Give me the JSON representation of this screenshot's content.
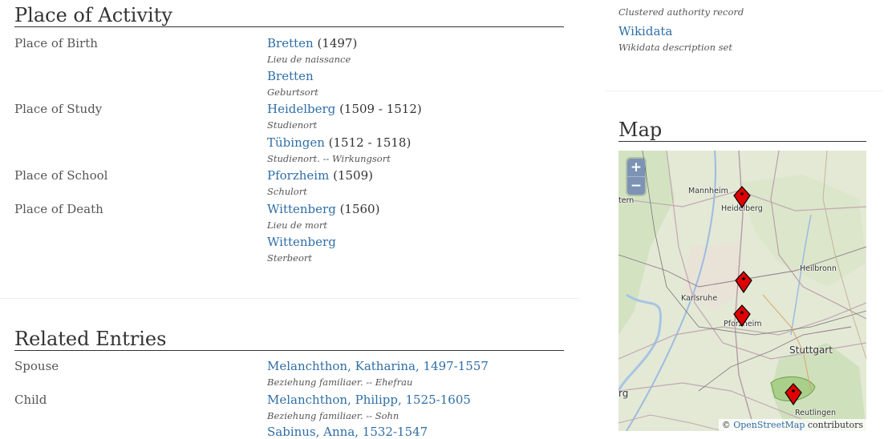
{
  "place_section": {
    "title": "Place of Activity",
    "rows": [
      {
        "label": "Place of Birth",
        "entries": [
          {
            "link": "Bretten",
            "years": "(1497)",
            "note": "Lieu de naissance"
          },
          {
            "link": "Bretten",
            "years": "",
            "note": "Geburtsort"
          }
        ]
      },
      {
        "label": "Place of Study",
        "entries": [
          {
            "link": "Heidelberg",
            "years": "(1509 - 1512)",
            "note": "Studienort"
          },
          {
            "link": "Tübingen",
            "years": "(1512 - 1518)",
            "note": "Studienort. -- Wirkungsort"
          }
        ]
      },
      {
        "label": "Place of School",
        "entries": [
          {
            "link": "Pforzheim",
            "years": "(1509)",
            "note": "Schulort"
          }
        ]
      },
      {
        "label": "Place of Death",
        "entries": [
          {
            "link": "Wittenberg",
            "years": "(1560)",
            "note": "Lieu de mort"
          },
          {
            "link": "Wittenberg",
            "years": "",
            "note": "Sterbeort"
          }
        ]
      }
    ]
  },
  "related_section": {
    "title": "Related Entries",
    "rows": [
      {
        "label": "Spouse",
        "link": "Melanchthon, Katharina, 1497-1557",
        "note": "Beziehung familiaer. -- Ehefrau"
      },
      {
        "label": "Child",
        "link": "Melanchthon, Philipp, 1525-1605",
        "note": "Beziehung familiaer. -- Sohn"
      },
      {
        "label": "",
        "link": "Sabinus, Anna, 1532-1547",
        "note": ""
      }
    ]
  },
  "sidebar": {
    "cluster_note": "Clustered authority record",
    "wikidata_link": "Wikidata",
    "wikidata_note": "Wikidata description set"
  },
  "map": {
    "title": "Map",
    "zoom_in": "+",
    "zoom_out": "−",
    "cities": [
      "Mannheim",
      "Heidelberg",
      "Heilbronn",
      "Karlsruhe",
      "Pforzheim",
      "Stuttgart",
      "Reutlingen",
      "tern",
      "rg"
    ],
    "attribution_prefix": "©",
    "attribution_link": "OpenStreetMap",
    "attribution_suffix": "contributors",
    "marker_color": "#e00000",
    "marker_icon": "map-pin-icon"
  }
}
